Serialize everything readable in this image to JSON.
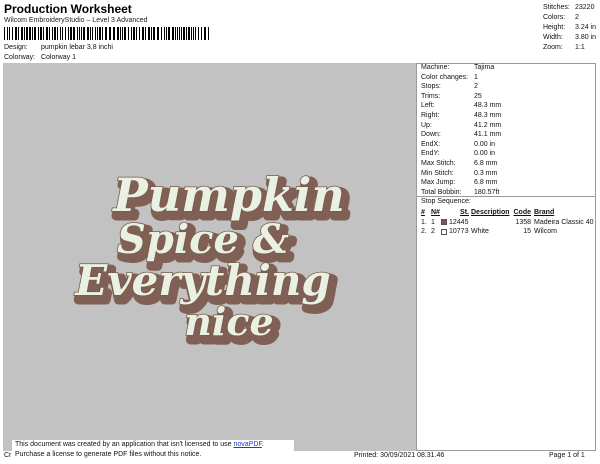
{
  "header": {
    "title": "Production Worksheet",
    "subtitle": "Wilcom EmbroideryStudio – Level 3 Advanced",
    "barcode_text": "*",
    "design_label": "Design:",
    "design_value": "pumpkin lebar 3,8 inchi",
    "colorway_label": "Colorway:",
    "colorway_value": "Colorway 1"
  },
  "top_stats": [
    {
      "label": "Stitches:",
      "value": "23220"
    },
    {
      "label": "Colors:",
      "value": "2"
    },
    {
      "label": "Height:",
      "value": "3.24 in"
    },
    {
      "label": "Width:",
      "value": "3.80 in"
    },
    {
      "label": "Zoom:",
      "value": "1:1"
    }
  ],
  "design_text": {
    "line1": "Pumpkin",
    "line2": "Spice &",
    "line3": "Everything",
    "line4": "nice"
  },
  "design_colors": {
    "fill": "#e9f1e3",
    "outline": "#7a5a4c",
    "shadow": "#806054",
    "canvas": "#c2c2c2"
  },
  "machine_info": [
    {
      "label": "Machine:",
      "value": "Tajima"
    },
    {
      "label": "Color changes:",
      "value": "1"
    },
    {
      "label": "Stops:",
      "value": "2"
    },
    {
      "label": "Trims:",
      "value": "25"
    },
    {
      "label": "Left:",
      "value": "48.3 mm"
    },
    {
      "label": "Right:",
      "value": "48.3 mm"
    },
    {
      "label": "Up:",
      "value": "41.2 mm"
    },
    {
      "label": "Down:",
      "value": "41.1 mm"
    },
    {
      "label": "EndX:",
      "value": "0.00 in"
    },
    {
      "label": "EndY:",
      "value": "0.00 in"
    },
    {
      "label": "Max Stitch:",
      "value": "6.8 mm"
    },
    {
      "label": "Min Stitch:",
      "value": "0.3 mm"
    },
    {
      "label": "Max Jump:",
      "value": "6.8 mm"
    },
    {
      "label": "Total Bobbin:",
      "value": "180.57ft"
    }
  ],
  "stop_sequence": {
    "title": "Stop Sequence:",
    "headers": [
      "#",
      "N#",
      "St.",
      "Description",
      "Code",
      "Brand"
    ],
    "rows": [
      {
        "num": "1.",
        "n": "1",
        "st": "12445",
        "description": "",
        "code": "1358",
        "brand": "Madeira Classic 40",
        "swatch": "#7a5a4c"
      },
      {
        "num": "2.",
        "n": "2",
        "st": "10773",
        "description": "White",
        "code": "15",
        "brand": "Wilcom",
        "swatch": "#ffffff"
      }
    ]
  },
  "footer": {
    "notice_line1": "This document was created by an application that isn't licensed to use ",
    "notice_link": "novaPDF",
    "notice_line1_end": ".",
    "notice_line2": "Purchase a license to generate PDF files without this notice.",
    "left_text": "Cr",
    "printed": "Printed: 30/09/2021 08.31.46",
    "page": "Page 1 of 1"
  }
}
